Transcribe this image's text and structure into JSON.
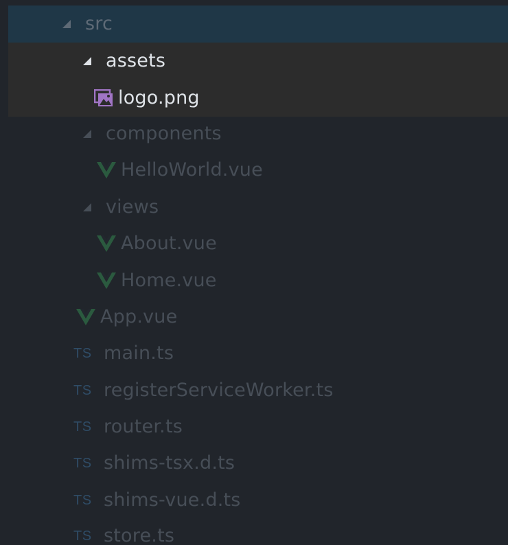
{
  "tree": {
    "rows": [
      {
        "label": "src",
        "kind": "folder-open",
        "icon": "chevron-down-icon",
        "state": "focused"
      },
      {
        "label": "assets",
        "kind": "folder-open",
        "icon": "chevron-down-icon",
        "state": "selected"
      },
      {
        "label": "logo.png",
        "kind": "file",
        "icon": "image-file-icon",
        "state": "selected"
      },
      {
        "label": "components",
        "kind": "folder-open",
        "icon": "chevron-down-icon",
        "state": "dim"
      },
      {
        "label": "HelloWorld.vue",
        "kind": "file",
        "icon": "vue-icon",
        "state": "dim"
      },
      {
        "label": "views",
        "kind": "folder-open",
        "icon": "chevron-down-icon",
        "state": "dim"
      },
      {
        "label": "About.vue",
        "kind": "file",
        "icon": "vue-icon",
        "state": "dim"
      },
      {
        "label": "Home.vue",
        "kind": "file",
        "icon": "vue-icon",
        "state": "dim"
      },
      {
        "label": "App.vue",
        "kind": "file",
        "icon": "vue-icon",
        "state": "dim"
      },
      {
        "label": "main.ts",
        "kind": "file",
        "icon": "typescript-icon",
        "icon_text": "TS",
        "state": "dim"
      },
      {
        "label": "registerServiceWorker.ts",
        "kind": "file",
        "icon": "typescript-icon",
        "icon_text": "TS",
        "state": "dim"
      },
      {
        "label": "router.ts",
        "kind": "file",
        "icon": "typescript-icon",
        "icon_text": "TS",
        "state": "dim"
      },
      {
        "label": "shims-tsx.d.ts",
        "kind": "file",
        "icon": "typescript-icon",
        "icon_text": "TS",
        "state": "dim"
      },
      {
        "label": "shims-vue.d.ts",
        "kind": "file",
        "icon": "typescript-icon",
        "icon_text": "TS",
        "state": "dim"
      },
      {
        "label": "store.ts",
        "kind": "file",
        "icon": "typescript-icon",
        "icon_text": "TS",
        "state": "dim"
      }
    ]
  },
  "colors": {
    "background": "#21252b",
    "focused_row": "#1f3747",
    "selected_row": "#2c2c2c",
    "vue_green": "#41b883",
    "image_icon_purple": "#a074c4",
    "ts_blue": "#2f4c66"
  }
}
